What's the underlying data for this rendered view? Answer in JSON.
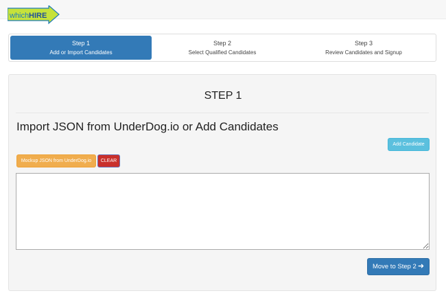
{
  "header": {
    "logo": {
      "prefix": "which",
      "suffix": "HIRE",
      "colors": {
        "arrow": "#c6e23a",
        "arrow_border": "#1f7db8",
        "prefix_text": "#1f7db8",
        "suffix_text": "#1f4f99"
      }
    }
  },
  "steps": [
    {
      "number": "Step 1",
      "label": "Add or Import Candidates",
      "active": true
    },
    {
      "number": "Step 2",
      "label": "Select Qualified Candidates",
      "active": false
    },
    {
      "number": "Step 3",
      "label": "Review Candidates and Signup",
      "active": false
    }
  ],
  "panel": {
    "title": "STEP 1",
    "heading": "Import JSON from UnderDog.io or Add Candidates",
    "add_candidate_label": "Add Candidate",
    "mockup_json_label": "Mockup JSON from UnderDog.io",
    "clear_label": "CLEAR",
    "json_value": "",
    "next_label": "Move to Step 2",
    "next_icon": "arrow-right-icon"
  },
  "colors": {
    "primary": "#337ab7",
    "info": "#5bc0de",
    "warning": "#f0ad4e",
    "danger": "#c9302c"
  }
}
